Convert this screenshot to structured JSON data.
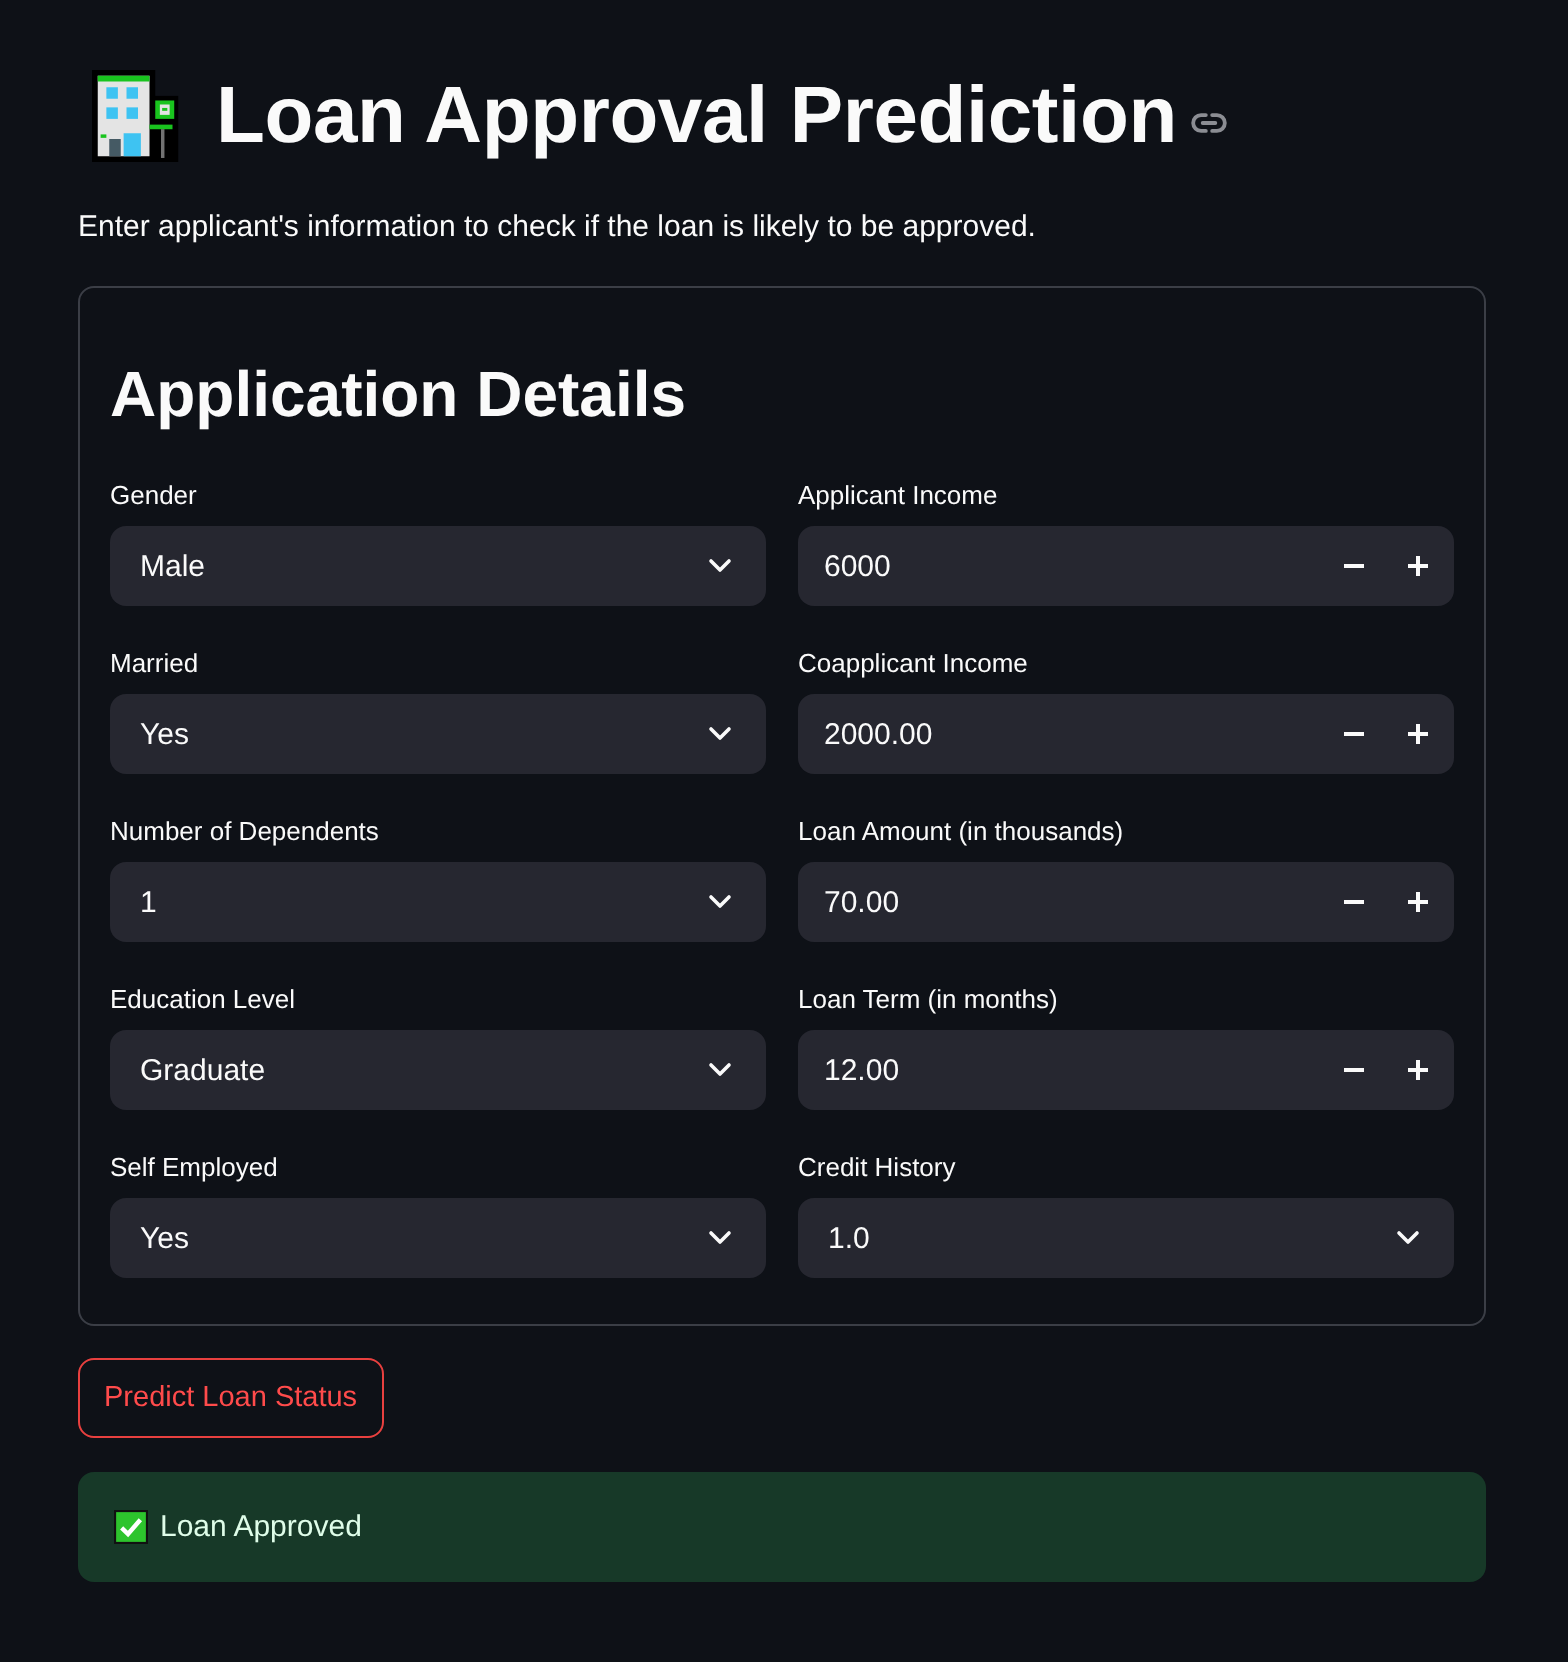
{
  "header": {
    "title": "Loan Approval Prediction",
    "subtitle": "Enter applicant's information to check if the loan is likely to be approved."
  },
  "form": {
    "heading": "Application Details",
    "columns": [
      {
        "fields": [
          {
            "label": "Gender",
            "kind": "select",
            "value": "Male"
          },
          {
            "label": "Married",
            "kind": "select",
            "value": "Yes"
          },
          {
            "label": "Number of Dependents",
            "kind": "select",
            "value": "1"
          },
          {
            "label": "Education Level",
            "kind": "select",
            "value": "Graduate"
          },
          {
            "label": "Self Employed",
            "kind": "select",
            "value": "Yes"
          }
        ]
      },
      {
        "fields": [
          {
            "label": "Applicant Income",
            "kind": "number",
            "value": "6000"
          },
          {
            "label": "Coapplicant Income",
            "kind": "number",
            "value": "2000.00"
          },
          {
            "label": "Loan Amount (in thousands)",
            "kind": "number",
            "value": "70.00"
          },
          {
            "label": "Loan Term (in months)",
            "kind": "number",
            "value": "12.00"
          },
          {
            "label": "Credit History",
            "kind": "select",
            "value": "1.0"
          }
        ]
      }
    ]
  },
  "predict_button": {
    "label": "Predict Loan Status"
  },
  "result": {
    "kind": "success",
    "text": "Loan Approved"
  }
}
